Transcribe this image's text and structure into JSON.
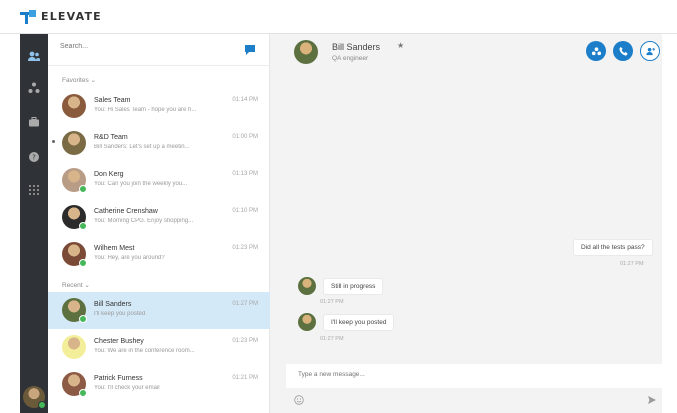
{
  "app": {
    "brand": "ELEVATE"
  },
  "sidebar": {
    "icons": [
      "contacts-icon",
      "org-chart-icon",
      "briefcase-icon",
      "help-icon",
      "apps-grid-icon"
    ]
  },
  "search": {
    "placeholder": "Search..."
  },
  "sections": {
    "favorites": "Favorites ⌄",
    "recent": "Recent ⌄"
  },
  "conversations": [
    {
      "name": "Sales Team",
      "preview": "You: Hi Sales Team - hope you are h...",
      "time": "01:14 PM",
      "avatar_color": "#8a5a3c",
      "online": false,
      "group": "favorites",
      "active": false
    },
    {
      "name": "R&D Team",
      "preview": "Bill Sanders: Let's set up a meetin...",
      "time": "01:00 PM",
      "avatar_color": "#7a6b45",
      "online": false,
      "group": "favorites",
      "active": false
    },
    {
      "name": "Don Kerg",
      "preview": "You: Can you join the weekly you...",
      "time": "01:13 PM",
      "avatar_color": "#b99c86",
      "online": true,
      "group": "favorites",
      "active": false
    },
    {
      "name": "Catherine Crenshaw",
      "preview": "You: Morning CPG. Enjoy shopping...",
      "time": "01:10 PM",
      "avatar_color": "#2b2b2b",
      "online": true,
      "group": "favorites",
      "active": false
    },
    {
      "name": "Wilhem Mest",
      "preview": "You: Hey, are you around?",
      "time": "01:23 PM",
      "avatar_color": "#7b4a36",
      "online": true,
      "group": "favorites",
      "active": false
    },
    {
      "name": "Bill Sanders",
      "preview": "I'll keep you posted",
      "time": "01:27 PM",
      "avatar_color": "#5d7140",
      "online": true,
      "group": "recent",
      "active": true
    },
    {
      "name": "Chester Bushey",
      "preview": "You: We are in the conference room...",
      "time": "01:23 PM",
      "avatar_color": "#f3ee9a",
      "online": false,
      "group": "recent",
      "active": false
    },
    {
      "name": "Patrick Furness",
      "preview": "You: I'll check your email",
      "time": "01:21 PM",
      "avatar_color": "#8d5b45",
      "online": true,
      "group": "recent",
      "active": false
    }
  ],
  "chat": {
    "contact_name": "Bill Sanders",
    "status": "QA engineer",
    "messages": [
      {
        "text": "Did all the tests pass?",
        "time": "01:27 PM",
        "outgoing": true
      },
      {
        "text": "Still in progress",
        "time": "01:27 PM",
        "outgoing": false
      },
      {
        "text": "I'll keep you posted",
        "time": "01:27 PM",
        "outgoing": false
      }
    ],
    "composer_placeholder": "Type a new message..."
  },
  "colors": {
    "accent": "#1c7ec9",
    "rail": "#2f3338",
    "active_row": "#d4e9f7",
    "online": "#47b85a"
  }
}
